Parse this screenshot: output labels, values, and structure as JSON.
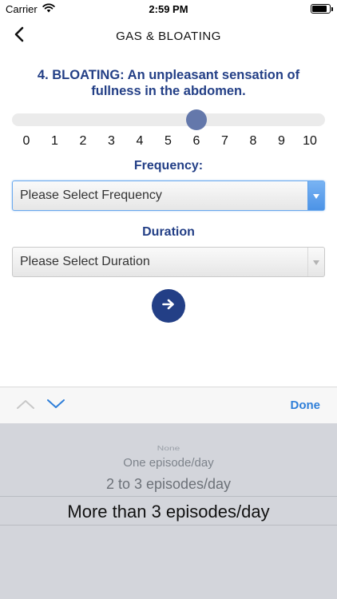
{
  "status_bar": {
    "carrier": "Carrier",
    "time": "2:59 PM",
    "battery_level": 0.85
  },
  "nav": {
    "title": "GAS & BLOATING",
    "back_icon": "chevron-left-icon"
  },
  "question": {
    "text": "4. BLOATING: An unpleasant sensation of fullness in the abdomen."
  },
  "slider": {
    "min": 0,
    "max": 10,
    "value": 6,
    "ticks": [
      "0",
      "1",
      "2",
      "3",
      "4",
      "5",
      "6",
      "7",
      "8",
      "9",
      "10"
    ]
  },
  "frequency": {
    "label": "Frequency:",
    "placeholder": "Please Select Frequency"
  },
  "duration": {
    "label": "Duration",
    "placeholder": "Please Select Duration"
  },
  "next_button": {
    "icon": "arrow-right-icon"
  },
  "toolbar": {
    "done_label": "Done",
    "prev_icon": "chevron-up-icon",
    "next_icon": "chevron-down-icon"
  },
  "picker": {
    "options": [
      "None",
      "One episode/day",
      "2 to 3 episodes/day",
      "More than 3 episodes/day"
    ],
    "selected_index": 3
  },
  "colors": {
    "brand": "#233f86",
    "thumb": "#6478ab",
    "link": "#2f7fd9",
    "picker_bg": "#d3d5db"
  }
}
